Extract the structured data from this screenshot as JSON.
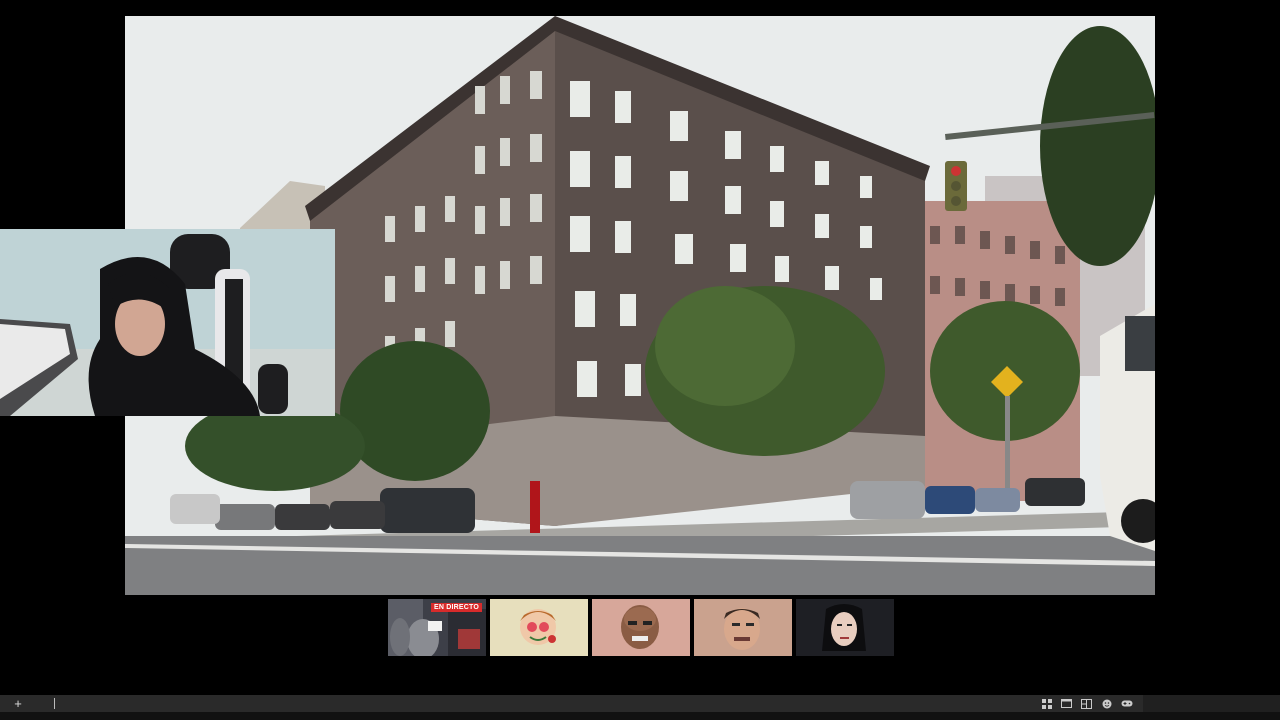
{
  "participants": [
    {
      "name": "streamer-tile",
      "live_label": "EN DIRECTO",
      "active": false
    },
    {
      "name": "cartoon-avatar-tile",
      "active": false
    },
    {
      "name": "bald-man-tile",
      "active": false
    },
    {
      "name": "man-face-tile",
      "active": true
    },
    {
      "name": "mj-face-tile",
      "active": false
    }
  ],
  "taskbar": {
    "add_icon": "plus-icon",
    "tray_icons": [
      "grid-icon",
      "window-icon",
      "layout-icon",
      "emoji-icon",
      "gamepad-icon"
    ]
  },
  "colors": {
    "live_badge": "#d72b2b",
    "active_outline": "#3f8f52",
    "taskbar": "#2a2a2a"
  }
}
